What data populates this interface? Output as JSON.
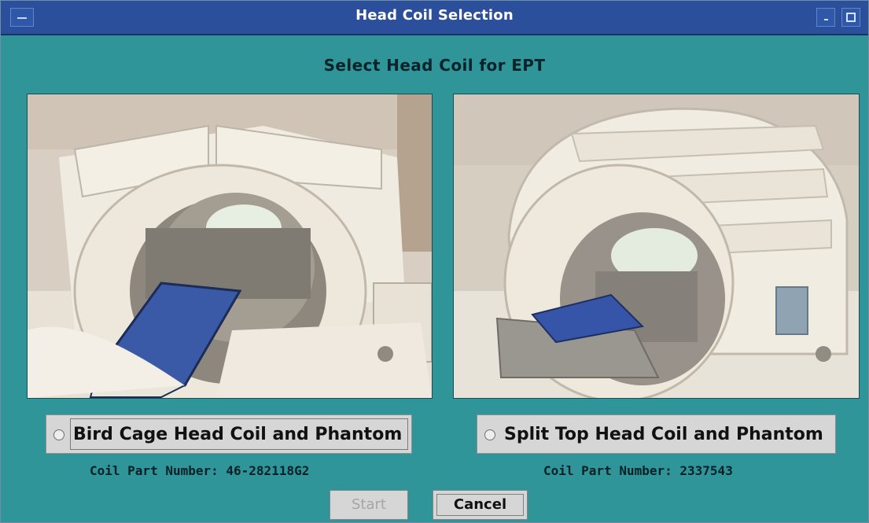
{
  "window": {
    "title": "Head Coil Selection",
    "heading": "Select Head Coil for EPT"
  },
  "options": [
    {
      "label": "Bird Cage Head Coil and Phantom",
      "part_number": "Coil Part Number: 46-282118G2",
      "selected": false
    },
    {
      "label": "Split Top Head Coil and Phantom",
      "part_number": "Coil Part Number: 2337543",
      "selected": false
    }
  ],
  "buttons": {
    "start": "Start",
    "cancel": "Cancel"
  },
  "colors": {
    "background": "#2f9598",
    "titlebar": "#2b4f9a"
  },
  "icons": {
    "window_menu": "window-menu-icon",
    "minimize": "minimize-icon",
    "maximize": "maximize-icon",
    "radio": "radio-button-icon"
  }
}
